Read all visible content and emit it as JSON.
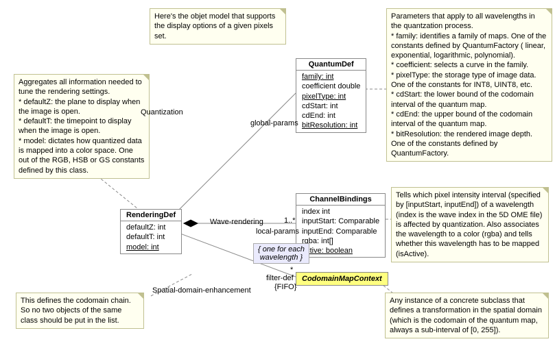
{
  "notes": {
    "topCenter": "Here's the objet model that supports the display options of a given pixels set.",
    "topLeft": "Aggregates all information needed to tune the rendering settings.\n* defaultZ: the plane to display when the image is open.\n* defaultT: the timepoint to display when the image is open.\n* model: dictates how quantized data is mapped into a color space. One out of the RGB, HSB or GS constants defined by this class.",
    "topRight": "Parameters that apply to all wavelengths in the quantzation process.\n* family: identifies a family of maps. One of the constants defined by QuantumFactory ( linear, exponential, logarithmic, polynomial).\n* coefficient: selects a curve in the family.\n* pixelType: the storage type of image data. One of the constants for INT8, UINT8, etc.\n* cdStart: the lower bound of the codomain interval of the quantum map.\n* cdEnd: the upper bound of the codomain interval of the quantum map.\n* bitResolution: the rendered image depth. One of the constants defined by QuantumFactory.",
    "midRight": "Tells which pixel intensity interval (specified by [inputStart, inputEnd]) of a wavelength (index is the wave index in the 5D OME file) is affected by quantization. Also associates the wavelength to a color (rgba) and tells whether this wavelength has to be mapped (isActive).",
    "bottomLeft": "This defines the codomain chain. So no two objects of the same class should be put in the list.",
    "bottomRight": "Any instance of a concrete subclass that defines a transformation in the spatial domain (which is the codomain of the quantum map, always a sub-interval of [0, 255])."
  },
  "classes": {
    "rendering": {
      "name": "RenderingDef",
      "attrs": [
        "defaultZ: int",
        "defaultT: int",
        "model: int"
      ]
    },
    "quantum": {
      "name": "QuantumDef",
      "attrs": [
        "family: int",
        "coefficient double",
        "pixelType: int",
        "cdStart: int",
        "cdEnd: int",
        "bitResolution: int"
      ]
    },
    "channel": {
      "name": "ChannelBindings",
      "attrs": [
        "index int",
        "inputStart: Comparable",
        "inputEnd: Comparable",
        "rgba: int[]",
        "active: boolean"
      ]
    },
    "codomain": {
      "name": "CodomainMapContext"
    }
  },
  "constraints": {
    "wavelength": "{ one for each wavelength }",
    "fifo": "{FIFO}"
  },
  "labels": {
    "quantization": "Quantization",
    "globalParams": "global-params",
    "waveRendering": "Wave-rendering",
    "localParams": "local-params",
    "oneStar": "1..*",
    "spatial": "Spatial-domain-enhancement",
    "filterDef": "filter-def",
    "star": "*"
  }
}
